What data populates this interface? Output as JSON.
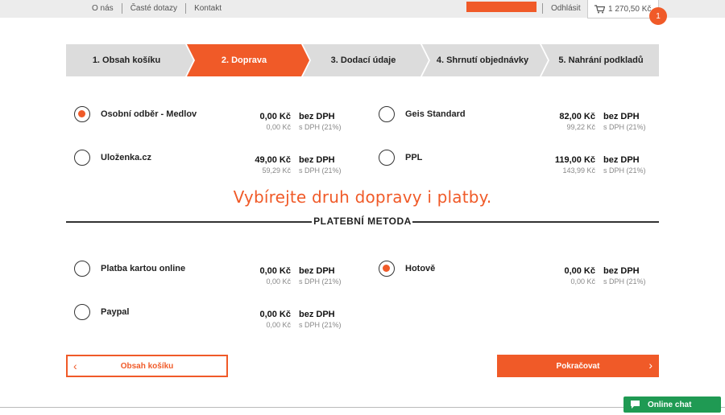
{
  "topbar": {
    "links": [
      "O nás",
      "Časté dotazy",
      "Kontakt"
    ],
    "logout": "Odhlásit",
    "cart_total": "1 270,50 Kč",
    "cart_count": "1",
    "accent": "#f05a28"
  },
  "steps": [
    {
      "label": "1. Obsah košíku",
      "active": false
    },
    {
      "label": "2. Doprava",
      "active": true
    },
    {
      "label": "3. Dodací údaje",
      "active": false
    },
    {
      "label": "4. Shrnutí objednávky",
      "active": false
    },
    {
      "label": "5. Nahrání podkladů",
      "active": false
    }
  ],
  "shipping": [
    {
      "name": "Osobní odběr - Medlov",
      "price": "0,00 Kč",
      "price_vat": "0,00 Kč",
      "selected": true
    },
    {
      "name": "Geis Standard",
      "price": "82,00 Kč",
      "price_vat": "99,22 Kč",
      "selected": false
    },
    {
      "name": "Uloženka.cz",
      "price": "49,00 Kč",
      "price_vat": "59,29 Kč",
      "selected": false
    },
    {
      "name": "PPL",
      "price": "119,00 Kč",
      "price_vat": "143,99 Kč",
      "selected": false
    }
  ],
  "payment": [
    {
      "name": "Platba kartou online",
      "price": "0,00 Kč",
      "price_vat": "0,00 Kč",
      "selected": false
    },
    {
      "name": "Hotově",
      "price": "0,00 Kč",
      "price_vat": "0,00 Kč",
      "selected": true
    },
    {
      "name": "Paypal",
      "price": "0,00 Kč",
      "price_vat": "0,00 Kč",
      "selected": false
    }
  ],
  "labels": {
    "no_vat": "bez DPH",
    "with_vat": "s DPH (21%)"
  },
  "warning": "Vybírejte druh dopravy i platby.",
  "payment_title": "PLATEBNÍ METODA",
  "buttons": {
    "back": "Obsah košíku",
    "next": "Pokračovat"
  },
  "chat": {
    "label": "Online chat",
    "color": "#1f9a53"
  }
}
